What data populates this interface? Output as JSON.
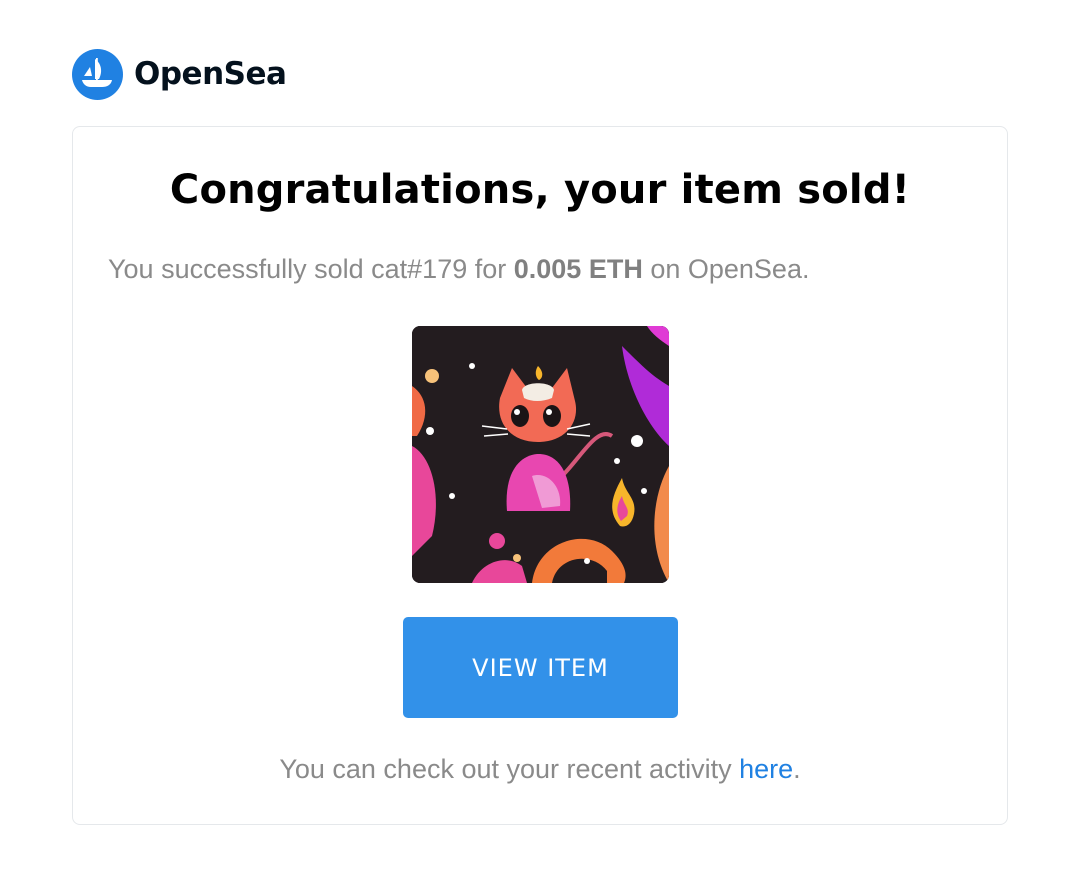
{
  "brand": {
    "name": "OpenSea",
    "logo_icon": "opensea-ship-icon",
    "color": "#2081e2"
  },
  "card": {
    "title": "Congratulations, your item sold!",
    "message_prefix": "You successfully sold cat#179 for ",
    "message_price": "0.005 ETH",
    "message_suffix": " on OpenSea.",
    "nft_image": "cat-nft-artwork",
    "button_label": "VIEW ITEM",
    "button_color": "#3291e9",
    "footer_prefix": "You can check out your recent activity ",
    "footer_link": "here",
    "footer_suffix": "."
  }
}
